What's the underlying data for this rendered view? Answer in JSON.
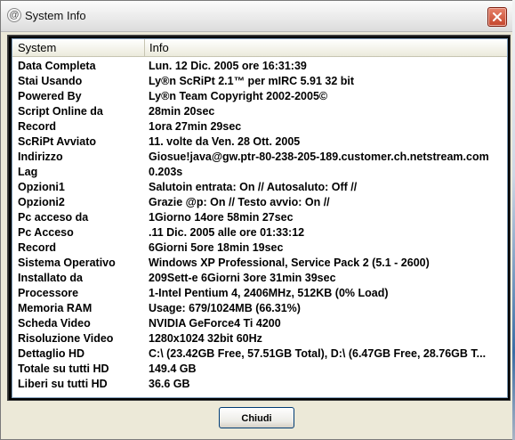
{
  "window": {
    "title": "System Info",
    "close_button_label": "X"
  },
  "table": {
    "headers": [
      "System",
      "Info"
    ],
    "rows": [
      [
        "Data Completa",
        "Lun. 12 Dic. 2005 ore 16:31:39"
      ],
      [
        "Stai Usando",
        "Ly®n ScRiPt 2.1™ per mIRC 5.91 32 bit"
      ],
      [
        "Powered By",
        "Ly®n Team Copyright 2002-2005©"
      ],
      [
        "Script Online da",
        "28min 20sec"
      ],
      [
        "Record",
        "1ora 27min 29sec"
      ],
      [
        "ScRiPt Avviato",
        "11. volte da Ven. 28 Ott. 2005"
      ],
      [
        "Indirizzo",
        "Giosue!java@gw.ptr-80-238-205-189.customer.ch.netstream.com"
      ],
      [
        "Lag",
        "0.203s"
      ],
      [
        "Opzioni1",
        "Salutoin entrata: On // Autosaluto: Off //"
      ],
      [
        "Opzioni2",
        "Grazie @p: On // Testo avvio: On //"
      ],
      [
        "Pc acceso da",
        "1Giorno 14ore 58min 27sec"
      ],
      [
        "Pc Acceso",
        ".11 Dic. 2005 alle ore 01:33:12"
      ],
      [
        "Record",
        "6Giorni 5ore 18min 19sec"
      ],
      [
        "Sistema Operativo",
        "Windows XP Professional, Service Pack 2 (5.1 - 2600)"
      ],
      [
        "Installato da",
        "209Sett-e 6Giorni 3ore 31min 39sec"
      ],
      [
        "Processore",
        "1-Intel Pentium 4, 2406MHz, 512KB (0% Load)"
      ],
      [
        "Memoria RAM",
        "Usage: 679/1024MB (66.31%)"
      ],
      [
        "Scheda Video",
        "NVIDIA GeForce4 Ti 4200"
      ],
      [
        "Risoluzione Video",
        "1280x1024 32bit 60Hz"
      ],
      [
        "Dettaglio HD",
        "C:\\ (23.42GB Free, 57.51GB Total), D:\\ (6.47GB Free, 28.76GB T..."
      ],
      [
        "Totale su tutti HD",
        "149.4 GB"
      ],
      [
        "Liberi su tutti HD",
        "36.6 GB"
      ]
    ]
  },
  "footer": {
    "close_label": "Chiudi"
  }
}
